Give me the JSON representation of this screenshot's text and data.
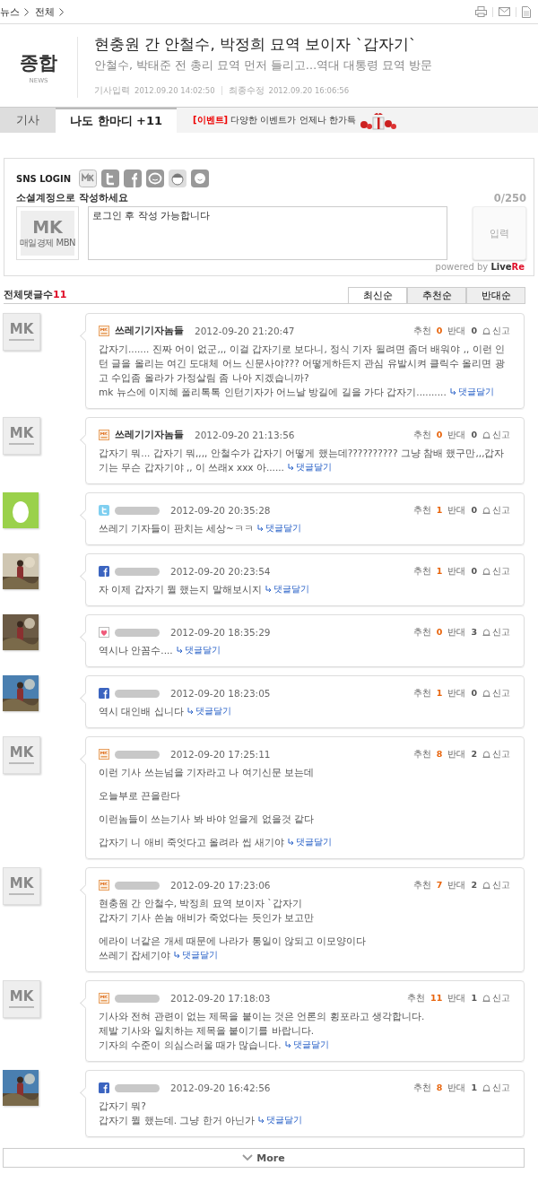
{
  "breadcrumb": [
    "뉴스",
    "전체"
  ],
  "header": {
    "section": "종합",
    "section_en": "NEWS",
    "title": "현충원 간 안철수, 박정희 묘역 보이자 `갑자기`",
    "subtitle": "안철수, 박태준 전 총리 묘역 먼저 들리고…역대 대통령 묘역 방문",
    "published_label": "기사입력",
    "published": "2012.09.20 14:02:50",
    "modified_label": "최종수정",
    "modified": "2012.09.20 16:06:56"
  },
  "tabs": [
    {
      "label": "기사",
      "selected": false
    },
    {
      "label": "나도 한마디 +11",
      "selected": true
    }
  ],
  "event": {
    "tag": "[이벤트]",
    "text": "다양한 이벤트가 언제나 한가득"
  },
  "comment_form": {
    "sns_label": "SNS LOGIN",
    "sns": [
      {
        "kind": "mk"
      },
      {
        "kind": "twitter"
      },
      {
        "kind": "facebook"
      },
      {
        "kind": "chat"
      },
      {
        "kind": "face"
      },
      {
        "kind": "smile"
      }
    ],
    "prompt": "소셜계정으로 작성하세요",
    "counter": "0/250",
    "avatar": {
      "mark": "MK",
      "caption": "매일경제 MBN"
    },
    "placeholder": "로그인 후 작성 가능합니다",
    "submit": "입력",
    "powered_by": "powered by",
    "brand": [
      "Live",
      "Re"
    ]
  },
  "count": {
    "label": "전체댓글수",
    "value": "11"
  },
  "sort": [
    {
      "label": "최신순",
      "selected": true
    },
    {
      "label": "추천순",
      "selected": false
    },
    {
      "label": "반대순",
      "selected": false
    }
  ],
  "comments": [
    {
      "avatar": {
        "kind": "mk",
        "mark": "MK"
      },
      "source_icon": {
        "kind": "mk"
      },
      "author": "쓰레기기자놈들",
      "time": "2012-09-20 21:20:47",
      "up_label": "추천",
      "up": "0",
      "down_label": "반대",
      "down": "0",
      "report": "신고",
      "paragraphs": [
        [
          "갑자기....... 진짜 어이 없군,,, 이걸 갑자기로 보다니, 정식 기자 될려면 좀더 배워야 ,, 이런 인턴 글을 올리는 여긴 도대체 어느 신문사야??? 어떻게하든지 관심 유발시켜 클릭수 올리면 광고 수입좀 올라가 가정살림 좀 나아 지겠습니까?",
          "mk 뉴스에 이지혜 폴리톡톡 인턴기자가 어느날 방길에 길을 가다 갑자기.........."
        ]
      ],
      "reply": "댓글달기"
    },
    {
      "avatar": {
        "kind": "mk",
        "mark": "MK"
      },
      "source_icon": {
        "kind": "mk"
      },
      "author": "쓰레기기자놈들",
      "time": "2012-09-20 21:13:56",
      "up_label": "추천",
      "up": "0",
      "down_label": "반대",
      "down": "0",
      "report": "신고",
      "paragraphs": [
        [
          "갑자기 뭐... 갑자기 뭐,,,, 안철수가 갑자기 어떻게 했는데?????????? 그냥 참배 했구만,,,갑자기는 무슨 갑자기야 ,, 이 쓰래x xxx 아......"
        ]
      ],
      "reply": "댓글달기"
    },
    {
      "avatar": {
        "kind": "egg"
      },
      "source_icon": {
        "kind": "twitter"
      },
      "time": "2012-09-20 20:35:28",
      "up_label": "추천",
      "up": "1",
      "down_label": "반대",
      "down": "0",
      "report": "신고",
      "paragraphs": [
        [
          "쓰레기 기자들이 판치는 세상~ㅋㅋ"
        ]
      ],
      "reply": "댓글달기"
    },
    {
      "avatar": {
        "kind": "picture"
      },
      "source_icon": {
        "kind": "facebook"
      },
      "time": "2012-09-20 20:23:54",
      "up_label": "추천",
      "up": "1",
      "down_label": "반대",
      "down": "0",
      "report": "신고",
      "paragraphs": [
        [
          "자 이제 갑자기 뭘 했는지 말해보시지"
        ]
      ],
      "reply": "댓글달기"
    },
    {
      "avatar": {
        "kind": "picture"
      },
      "source_icon": {
        "kind": "cyworld"
      },
      "time": "2012-09-20 18:35:29",
      "up_label": "추천",
      "up": "0",
      "down_label": "반대",
      "down": "3",
      "report": "신고",
      "paragraphs": [
        [
          "역시나 안꼼수...."
        ]
      ],
      "reply": "댓글달기"
    },
    {
      "avatar": {
        "kind": "picture"
      },
      "source_icon": {
        "kind": "facebook"
      },
      "time": "2012-09-20 18:23:05",
      "up_label": "추천",
      "up": "1",
      "down_label": "반대",
      "down": "0",
      "report": "신고",
      "paragraphs": [
        [
          "역시 대인배 십니다"
        ]
      ],
      "reply": "댓글달기"
    },
    {
      "avatar": {
        "kind": "mk",
        "mark": "MK"
      },
      "source_icon": {
        "kind": "mk"
      },
      "time": "2012-09-20 17:25:11",
      "up_label": "추천",
      "up": "8",
      "down_label": "반대",
      "down": "2",
      "report": "신고",
      "paragraphs": [
        [
          "이런 기사 쓰는넘을 기자라고 나 여기신문 보는데"
        ],
        [
          "오늘부로 끈을란다"
        ],
        [
          "이런놈들이 쓰는기사 봐 바야 얻을게 없을것 같다"
        ],
        [
          "갑자기 니 애비 죽엇다고 올려라 씹 새기야"
        ]
      ],
      "reply": "댓글달기"
    },
    {
      "avatar": {
        "kind": "mk",
        "mark": "MK"
      },
      "source_icon": {
        "kind": "mk"
      },
      "time": "2012-09-20 17:23:06",
      "up_label": "추천",
      "up": "7",
      "down_label": "반대",
      "down": "2",
      "report": "신고",
      "paragraphs": [
        [
          "현충원 간 안철수, 박정희 묘역 보이자 `갑자기",
          "갑자기 기사 쓴놈 애비가 죽었다는 듯인가 보고만"
        ],
        [
          "에라이 너같은 개세 때문에 나라가 통일이 않되고 이모양이다",
          "쓰레기 잡세기야"
        ]
      ],
      "reply": "댓글달기"
    },
    {
      "avatar": {
        "kind": "mk",
        "mark": "MK"
      },
      "source_icon": {
        "kind": "mk"
      },
      "time": "2012-09-20 17:18:03",
      "up_label": "추천",
      "up": "11",
      "down_label": "반대",
      "down": "1",
      "report": "신고",
      "paragraphs": [
        [
          "기사와 전혀 관련이 없는 제목을 붙이는 것은 언론의 횡포라고 생각합니다.",
          "제발 기사와 일치하는 제목을 붙이기를 바랍니다.",
          "기자의 수준이 의심스러울 때가 많습니다."
        ]
      ],
      "reply": "댓글달기"
    },
    {
      "avatar": {
        "kind": "picture"
      },
      "source_icon": {
        "kind": "facebook"
      },
      "time": "2012-09-20 16:42:56",
      "up_label": "추천",
      "up": "8",
      "down_label": "반대",
      "down": "1",
      "report": "신고",
      "paragraphs": [
        [
          "갑자기 뭐?",
          "갑자기 뭘 했는데. 그냥 한거 아닌가"
        ]
      ],
      "reply": "댓글달기"
    }
  ],
  "more": "More"
}
